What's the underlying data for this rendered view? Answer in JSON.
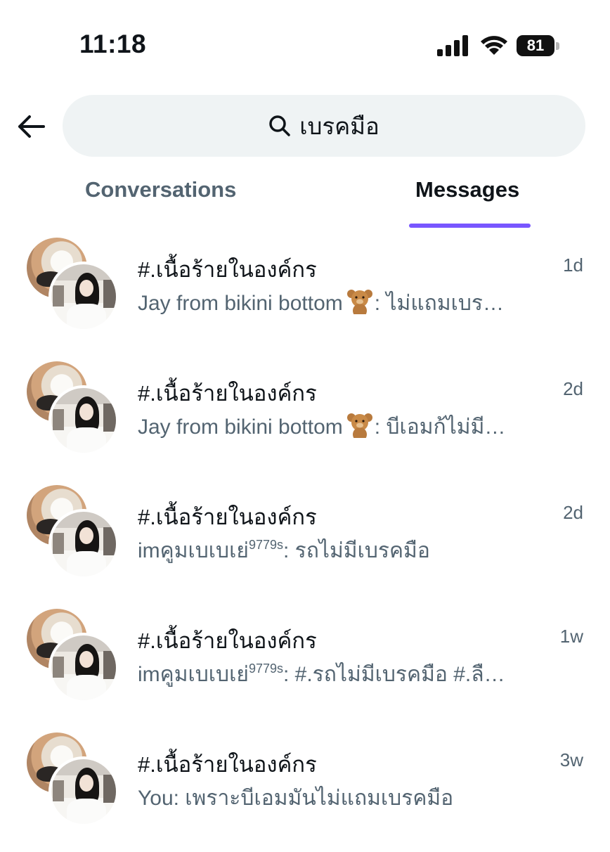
{
  "status_bar": {
    "time": "11:18",
    "battery": "81"
  },
  "header": {
    "search_query": "เบรคมือ"
  },
  "tabs": [
    {
      "label": "Conversations",
      "active": false
    },
    {
      "label": "Messages",
      "active": true
    }
  ],
  "accent_color": "#7856ff",
  "messages": [
    {
      "title": "#.เนื้อร้ายในองค์กร",
      "time": "1d",
      "sender": "Jay from bikini bottom",
      "sender_emoji": "teddy-bear-icon",
      "text": ": ไม่แถมเบร…"
    },
    {
      "title": "#.เนื้อร้ายในองค์กร",
      "time": "2d",
      "sender": "Jay from bikini bottom",
      "sender_emoji": "teddy-bear-icon",
      "text": ": บีเอมก้ไม่มี…"
    },
    {
      "title": "#.เนื้อร้ายในองค์กร",
      "time": "2d",
      "sender": "imคูมเบเบเย่",
      "sender_sup": "9779s",
      "text": ": รถไม่มีเบรคมือ"
    },
    {
      "title": "#.เนื้อร้ายในองค์กร",
      "time": "1w",
      "sender": "imคูมเบเบเย่",
      "sender_sup": "9779s",
      "text": ": #.รถไม่มีเบรคมือ #.ลื…"
    },
    {
      "title": "#.เนื้อร้ายในองค์กร",
      "time": "3w",
      "sender": "You",
      "text": ": เพราะบีเอมมันไม่แถมเบรคมือ"
    }
  ]
}
